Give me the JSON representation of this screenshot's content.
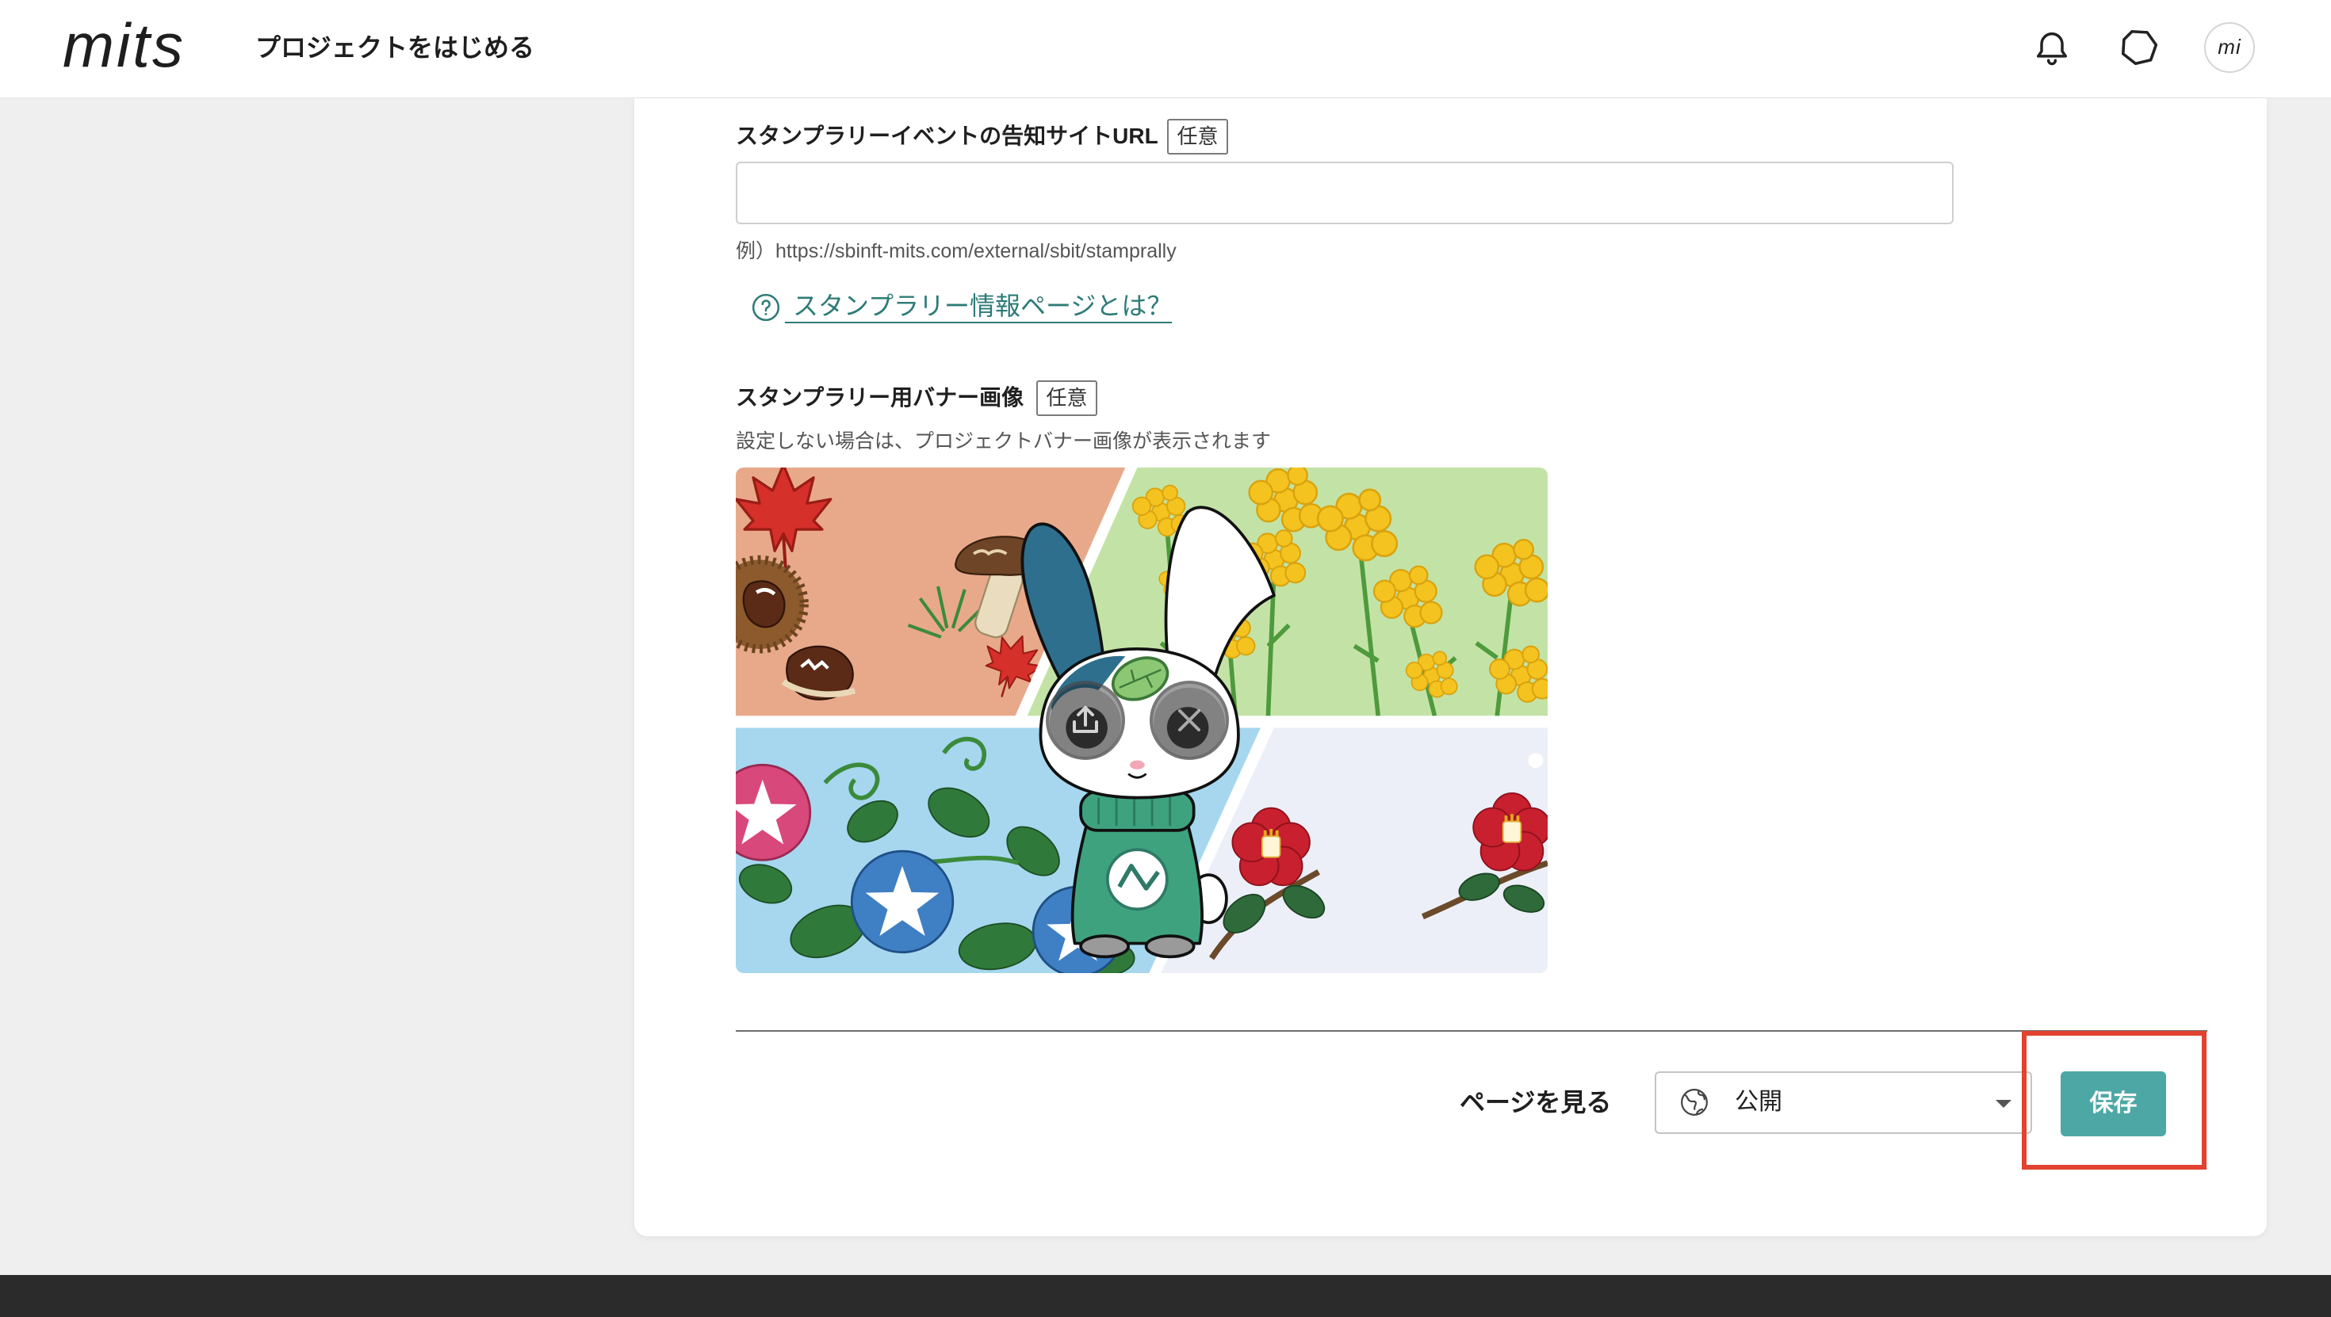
{
  "header": {
    "logo": "mits",
    "title": "プロジェクトをはじめる",
    "notification_icon": "bell-icon",
    "wallet_icon": "hexagon-icon",
    "avatar_logo": "mi"
  },
  "form": {
    "event_url": {
      "label": "スタンプラリーイベントの告知サイトURL",
      "badge": "任意",
      "value": "",
      "example": "例）https://sbinft-mits.com/external/sbit/stamprally"
    },
    "help_link": {
      "icon": "question-circle-icon",
      "text": "スタンプラリー情報ページとは？"
    },
    "banner": {
      "label": "スタンプラリー用バナー画像",
      "badge": "任意",
      "note": "設定しない場合は、プロジェクトバナー画像が表示されます",
      "upload_icon": "upload-icon",
      "remove_icon": "close-icon"
    }
  },
  "actions": {
    "view_page": "ページを見る",
    "visibility": {
      "icon": "globe-icon",
      "selected": "公開"
    },
    "save": "保存"
  },
  "colors": {
    "accent": "#4da8a5",
    "link": "#2d7b77",
    "highlight": "#e2422f",
    "page_bg": "#efefef",
    "footer_bg": "#2b2b2b"
  }
}
